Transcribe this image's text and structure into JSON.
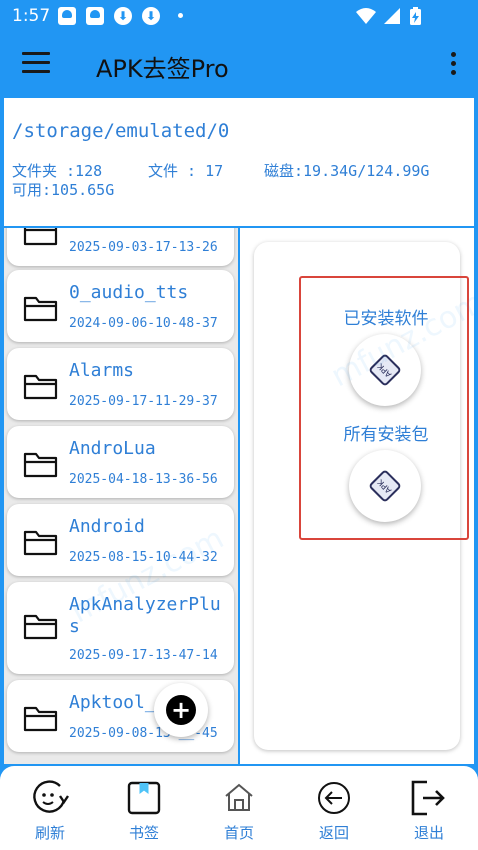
{
  "status_bar": {
    "time": "1:57",
    "icons": [
      "app-notification-icon",
      "app-notification-icon",
      "download-icon",
      "download-icon",
      "dot-icon",
      "wifi-icon",
      "signal-icon",
      "battery-charging-icon"
    ]
  },
  "app_bar": {
    "title": "APK去签Pro",
    "menu_icon": "menu-icon",
    "more_icon": "more-vert-icon"
  },
  "path_info": {
    "path": "/storage/emulated/0",
    "folders": "文件夹 :128",
    "files": "文件 : 17",
    "disk": "磁盘:19.34G/124.99G",
    "available": "可用:105.65G"
  },
  "file_list": [
    {
      "name": "",
      "date": "2025-09-03-17-13-26"
    },
    {
      "name": "0_audio_tts",
      "date": "2024-09-06-10-48-37"
    },
    {
      "name": "Alarms",
      "date": "2025-09-17-11-29-37"
    },
    {
      "name": "AndroLua",
      "date": "2025-04-18-13-36-56"
    },
    {
      "name": "Android",
      "date": "2025-08-15-10-44-32"
    },
    {
      "name": "ApkAnalyzerPlus",
      "date": "2025-09-17-13-47-14"
    },
    {
      "name": "Apktool_",
      "date": "2025-09-08-13-__-45"
    }
  ],
  "actions": {
    "installed": "已安装软件",
    "all_packages": "所有安装包",
    "apk_icon_text": "APK"
  },
  "bottom_nav": [
    {
      "label": "刷新",
      "icon": "refresh-face-icon"
    },
    {
      "label": "书签",
      "icon": "bookmark-icon"
    },
    {
      "label": "首页",
      "icon": "home-icon"
    },
    {
      "label": "返回",
      "icon": "back-arrow-icon"
    },
    {
      "label": "退出",
      "icon": "exit-icon"
    }
  ],
  "watermark": "mfunz.com",
  "colors": {
    "primary": "#2196f3",
    "text_blue": "#2f7fd6",
    "highlight": "#d9453b"
  }
}
